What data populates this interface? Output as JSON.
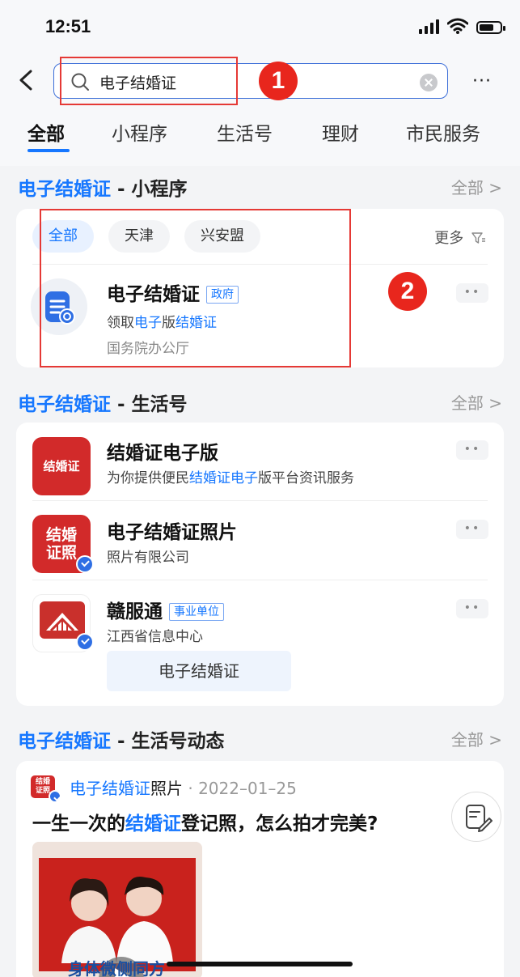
{
  "status": {
    "time": "12:51"
  },
  "search": {
    "query": "电子结婚证",
    "more": "···"
  },
  "tabs": [
    "全部",
    "小程序",
    "生活号",
    "理财",
    "市民服务"
  ],
  "annotations": {
    "badge1": "1",
    "badge2": "2"
  },
  "section_miniapp": {
    "title_keyword": "电子结婚证",
    "title_suffix": " - 小程序",
    "all_label": "全部 >",
    "chips": [
      "全部",
      "天津",
      "兴安盟"
    ],
    "more_filter": "更多",
    "result": {
      "name": "电子结婚证",
      "tag": "政府",
      "desc_prefix": "领取",
      "desc_kw1": "电子",
      "desc_mid": "版",
      "desc_kw2": "结婚证",
      "provider": "国务院办公厅"
    }
  },
  "section_life": {
    "title_keyword": "电子结婚证",
    "title_suffix": " - 生活号",
    "all_label": "全部 >",
    "items": [
      {
        "name": "结婚证电子版",
        "logo_text": "结婚证",
        "desc_prefix": "为你提供便民",
        "desc_kw": "结婚证电子",
        "desc_suffix": "版平台资讯服务"
      },
      {
        "name": "电子结婚证照片",
        "logo_text_1": "结婚",
        "logo_text_2": "证照",
        "desc": "照片有限公司"
      },
      {
        "name": "赣服通",
        "tag": "事业单位",
        "desc": "江西省信息中心",
        "sub_service": "电子结婚证"
      }
    ]
  },
  "section_feed": {
    "title_keyword": "电子结婚证",
    "title_suffix": " - 生活号动态",
    "all_label": "全部 >",
    "post": {
      "source_kw": "电子结婚证",
      "source_suffix": "照片",
      "date": " · 2022–01–25",
      "title_prefix": "一生一次的",
      "title_kw": "结婚证",
      "title_suffix": "登记照，怎么拍才完美?",
      "image_overlay": "身体微侧同方"
    }
  }
}
